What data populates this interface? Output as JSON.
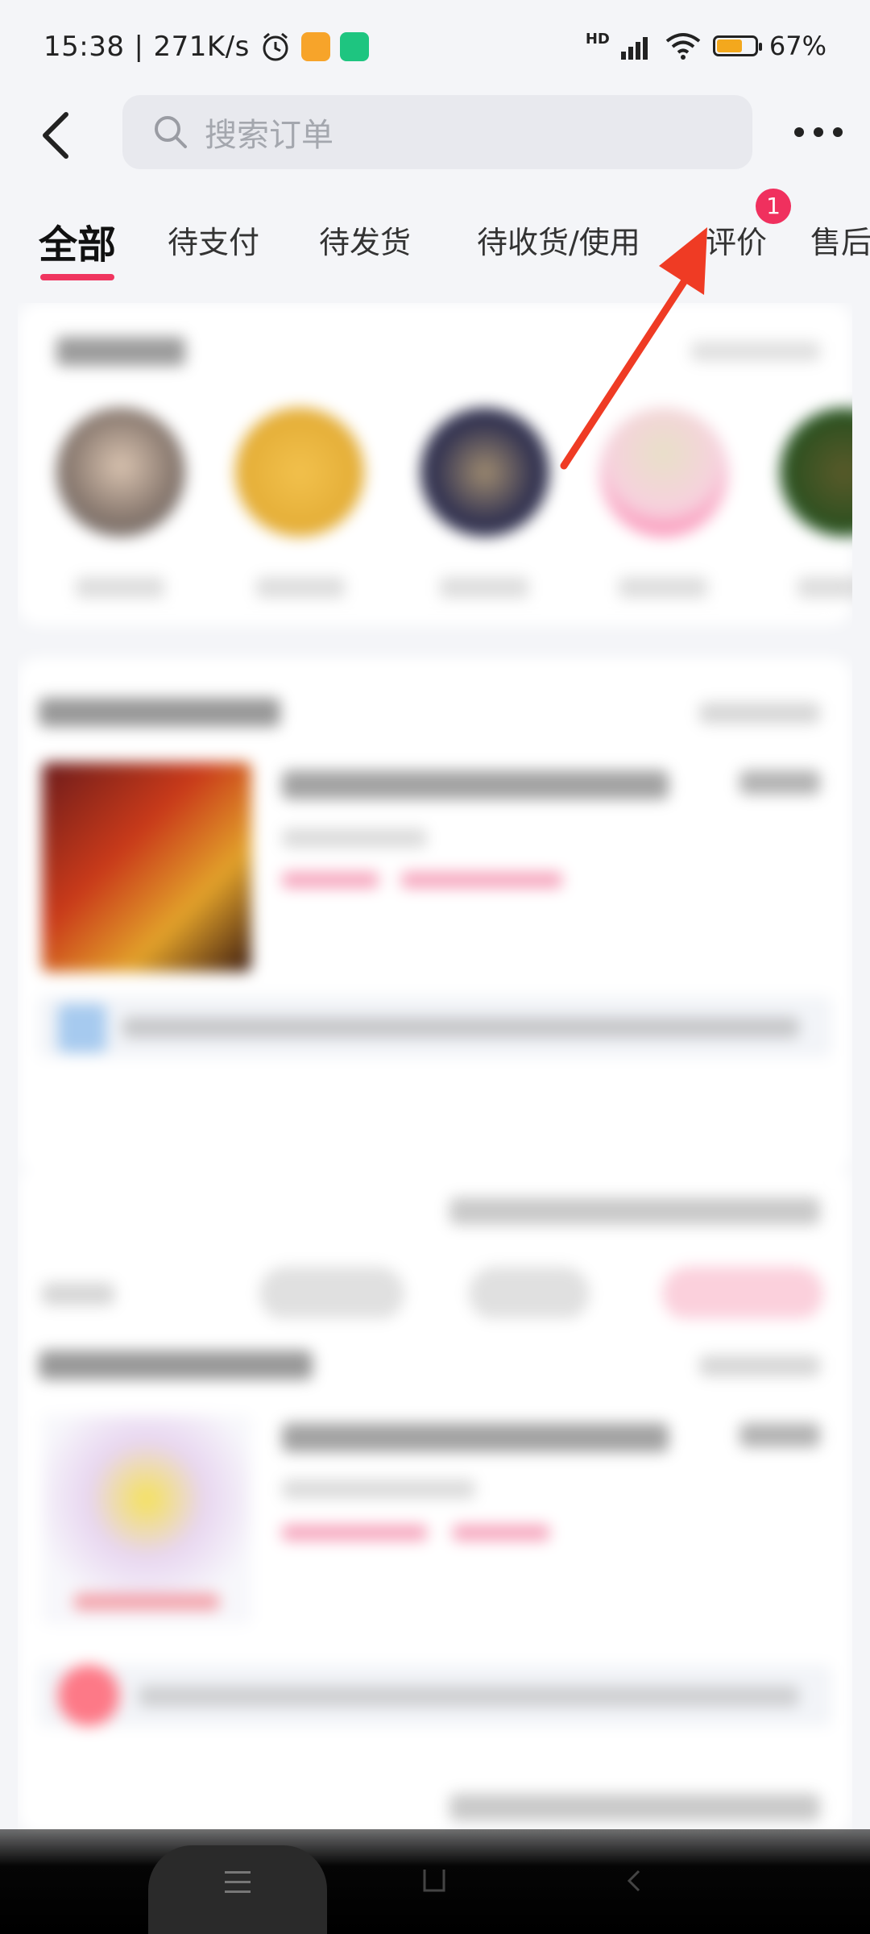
{
  "status_bar": {
    "time": "15:38",
    "network_speed": "271K/s",
    "separator": "|",
    "signal_label": "HD",
    "battery_percent": "67%",
    "battery_level": 0.67,
    "icons": [
      "alarm-icon",
      "notes-app-icon",
      "shield-app-icon",
      "signal-icon",
      "wifi-icon",
      "battery-icon"
    ]
  },
  "header": {
    "back_icon": "chevron-left-icon",
    "search_placeholder": "搜索订单",
    "more_icon": "more-dots-icon"
  },
  "tabs": [
    {
      "label": "全部",
      "active": true
    },
    {
      "label": "待支付",
      "active": false
    },
    {
      "label": "待发货",
      "active": false
    },
    {
      "label": "待收货/使用",
      "active": false
    },
    {
      "label": "评价",
      "active": false
    },
    {
      "label": "售后",
      "active": false
    }
  ],
  "review_badge": "1",
  "colors": {
    "accent": "#f0355f",
    "badge": "#f0305e",
    "arrow": "#ef3b24",
    "background": "#f4f5f8"
  },
  "nav_bar": {
    "menu_icon": "menu-icon",
    "home_icon": "home-square-icon",
    "back_icon": "nav-back-icon"
  }
}
